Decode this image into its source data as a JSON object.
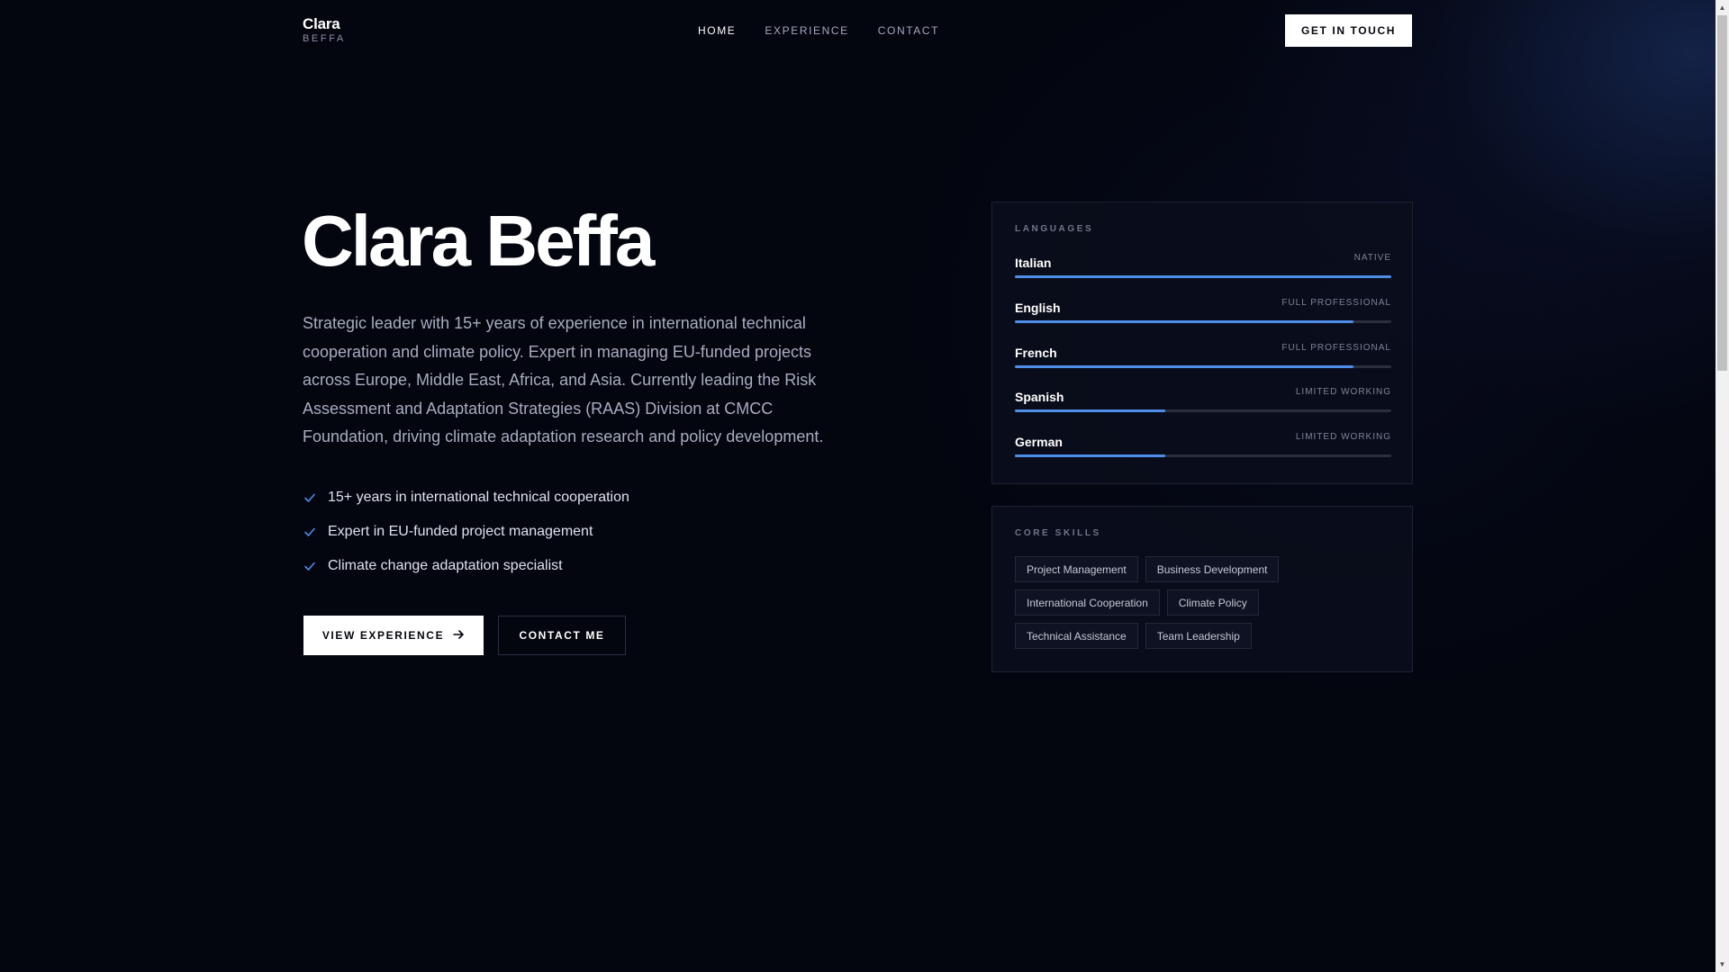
{
  "brand": {
    "first": "Clara",
    "last": "BEFFA"
  },
  "nav": [
    {
      "label": "HOME",
      "active": true
    },
    {
      "label": "EXPERIENCE",
      "active": false
    },
    {
      "label": "CONTACT",
      "active": false
    }
  ],
  "header_cta": "GET IN TOUCH",
  "hero": {
    "title": "Clara Beffa",
    "description": "Strategic leader with 15+ years of experience in international technical cooperation and climate policy. Expert in managing EU-funded projects across Europe, Middle East, Africa, and Asia. Currently leading the Risk Assessment and Adaptation Strategies (RAAS) Division at CMCC Foundation, driving climate adaptation research and policy development.",
    "highlights": [
      "15+ years in international technical cooperation",
      "Expert in EU-funded project management",
      "Climate change adaptation specialist"
    ],
    "primary_button": "VIEW EXPERIENCE",
    "secondary_button": "CONTACT ME"
  },
  "languages": {
    "label": "LANGUAGES",
    "items": [
      {
        "name": "Italian",
        "level": "NATIVE",
        "proficiency": 1.0
      },
      {
        "name": "English",
        "level": "FULL PROFESSIONAL",
        "proficiency": 0.9
      },
      {
        "name": "French",
        "level": "FULL PROFESSIONAL",
        "proficiency": 0.9
      },
      {
        "name": "Spanish",
        "level": "LIMITED WORKING",
        "proficiency": 0.4
      },
      {
        "name": "German",
        "level": "LIMITED WORKING",
        "proficiency": 0.4
      }
    ]
  },
  "skills": {
    "label": "CORE SKILLS",
    "rows": [
      [
        "Project Management",
        "Business Development"
      ],
      [
        "International Cooperation",
        "Climate Policy"
      ],
      [
        "Technical Assistance",
        "Team Leadership"
      ]
    ]
  },
  "colors": {
    "background": "#03050f",
    "accent": "#4e8ee8",
    "card": "#0a0e1c"
  }
}
